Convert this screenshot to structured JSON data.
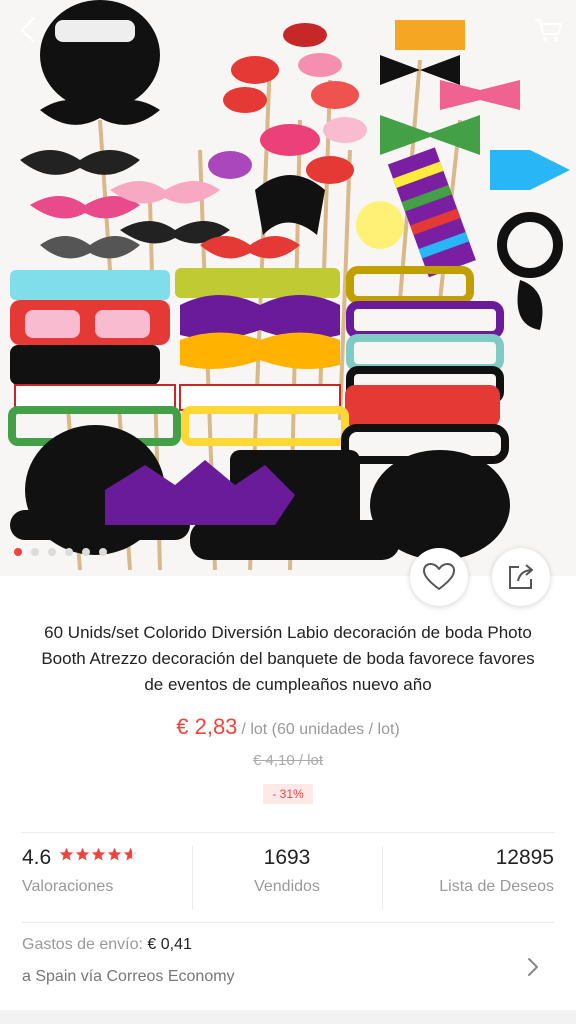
{
  "gallery": {
    "image_alt": "Party photo booth props: moustaches, lips, bow ties, glasses and hats",
    "dot_count": 6,
    "active_dot": 0
  },
  "icons": {
    "back": "chevron-left-icon",
    "cart": "shopping-cart-icon",
    "wishlist": "heart-outline-icon",
    "share": "share-icon",
    "shipping_more": "chevron-right-icon"
  },
  "product": {
    "title": "60 Unids/set Colorido Diversión Labio decoración de boda Photo Booth Atrezzo decoración del banquete de boda favorece favores de eventos de cumpleaños nuevo año",
    "price": "€ 2,83",
    "unit": "/ lot (60 unidades / lot)",
    "original_price": "€ 4,10 / lot",
    "discount": "- 31%"
  },
  "stats": {
    "rating_value": "4.6",
    "rating_stars": 4.6,
    "rating_label": "Valoraciones",
    "sold_value": "1693",
    "sold_label": "Vendidos",
    "wishlist_value": "12895",
    "wishlist_label": "Lista de Deseos"
  },
  "shipping": {
    "label": "Gastos de envío:",
    "value": "€ 0,41",
    "detail": "a Spain vía Correos Economy"
  },
  "colors": {
    "accent": "#f4433c",
    "muted": "#999999",
    "divider": "#ececec"
  }
}
